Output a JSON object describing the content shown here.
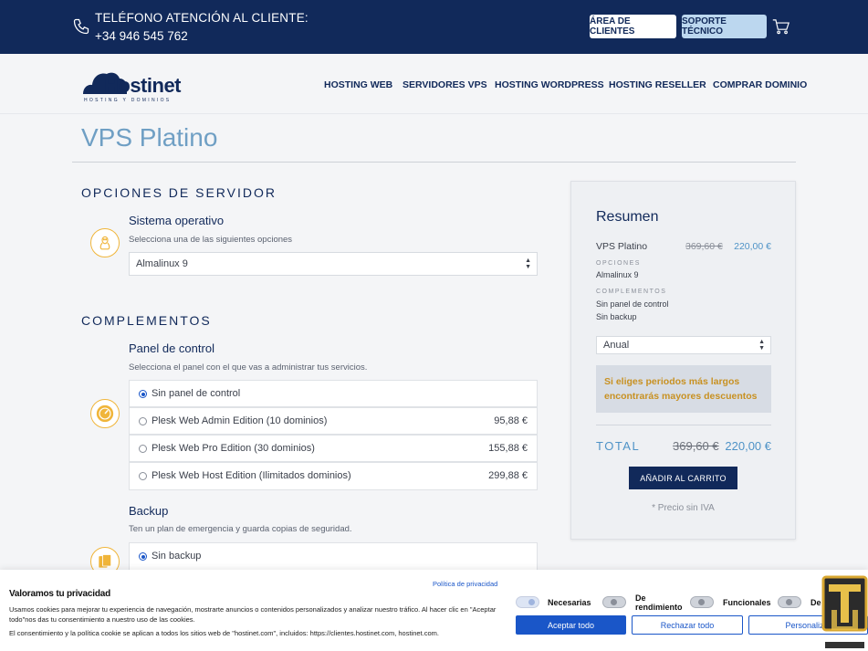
{
  "topbar": {
    "phone_label": "TELÉFONO ATENCIÓN AL CLIENTE:",
    "phone_number": "+34 946 545 762",
    "clients_button": "ÁREA DE CLIENTES",
    "support_button": "SOPORTE TÉCNICO"
  },
  "header": {
    "logo_text": "Hostinet",
    "logo_sub": "HOSTING Y DOMINIOS",
    "nav": [
      "HOSTING WEB",
      "SERVIDORES VPS",
      "HOSTING WORDPRESS",
      "HOSTING RESELLER",
      "COMPRAR DOMINIO"
    ]
  },
  "page_title": "VPS Platino",
  "server_options": {
    "section_title": "OPCIONES DE SERVIDOR",
    "os_title": "Sistema operativo",
    "os_desc": "Selecciona una de las siguientes opciones",
    "os_selected": "Almalinux 9"
  },
  "addons": {
    "section_title": "COMPLEMENTOS",
    "panel_title": "Panel de control",
    "panel_desc": "Selecciona el panel con el que vas a administrar tus servicios.",
    "panel_options": [
      {
        "label": "Sin panel de control",
        "price": "",
        "selected": true
      },
      {
        "label": "Plesk Web Admin Edition (10 dominios)",
        "price": "95,88 €",
        "selected": false
      },
      {
        "label": "Plesk Web Pro Edition (30 dominios)",
        "price": "155,88 €",
        "selected": false
      },
      {
        "label": "Plesk Web Host Edition (Ilimitados dominios)",
        "price": "299,88 €",
        "selected": false
      }
    ],
    "backup_title": "Backup",
    "backup_desc": "Ten un plan de emergencia y guarda copias de seguridad.",
    "backup_options": [
      {
        "label": "Sin backup",
        "selected": true
      }
    ]
  },
  "summary": {
    "title": "Resumen",
    "product": "VPS Platino",
    "old_price": "369,60 €",
    "new_price": "220,00 €",
    "options_caption": "OPCIONES",
    "options_value": "Almalinux 9",
    "addons_caption": "COMPLEMENTOS",
    "addon_1": "Sin panel de control",
    "addon_2": "Sin backup",
    "billing": "Anual",
    "promo": "Si eliges periodos más largos encontrarás mayores descuentos",
    "total_label": "TOTAL",
    "total_old": "369,60 €",
    "total_new": "220,00 €",
    "add_to_cart": "AÑADIR AL CARRITO",
    "vat_note": "* Precio sin IVA"
  },
  "cookie": {
    "title": "Valoramos tu privacidad",
    "policy_link": "Política de privacidad",
    "text": "Usamos cookies para mejorar tu experiencia de navegación, mostrarte anuncios o contenidos personalizados y analizar nuestro tráfico. Al hacer clic en \"Aceptar todo\"nos das tu consentimiento a nuestro uso de las cookies.",
    "text2": "El consentimiento y la política cookie se aplican a todos los sitios web de \"hostinet.com\", incluidos: https://clientes.hostinet.com, hostinet.com.",
    "toggles": [
      "Necesarias",
      "De rendimiento",
      "Funcionales",
      "De publicidad"
    ],
    "accept": "Aceptar todo",
    "reject": "Rechazar todo",
    "customize": "Personalizar"
  },
  "colors": {
    "navy": "#11295a",
    "accent_blue": "#4f93c7",
    "promo_gold": "#c89122",
    "icon_orange": "#f0b53a"
  }
}
